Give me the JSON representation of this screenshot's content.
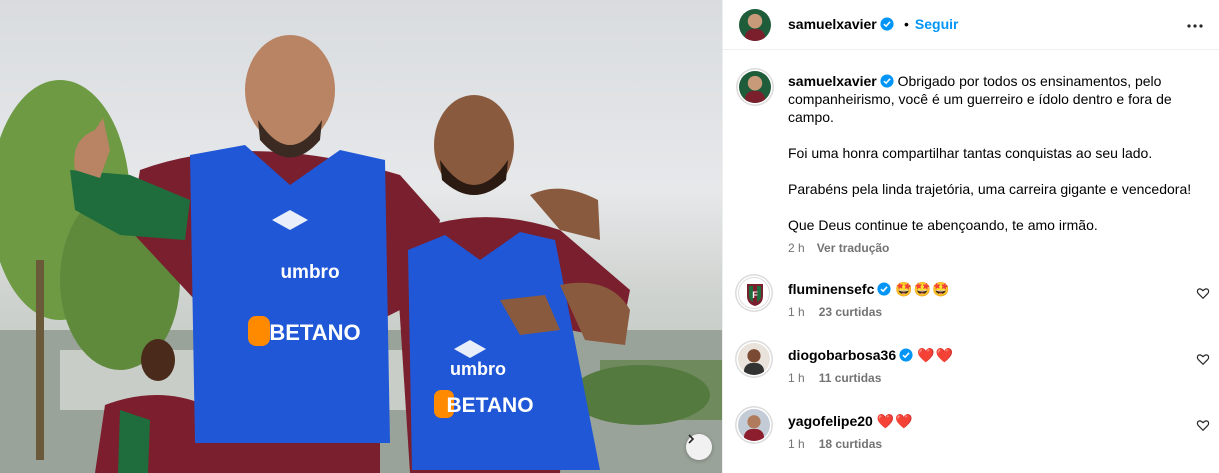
{
  "post": {
    "author": "samuelxavier",
    "follow_label": "Seguir",
    "dot": "•",
    "photo_text": {
      "left_brand": "umbro",
      "left_sponsor": "BETANO",
      "right_brand": "umbro",
      "right_sponsor": "BETANO"
    },
    "caption": {
      "username": "samuelxavier",
      "paragraphs": [
        "Obrigado por todos os ensinamentos, pelo companheirismo, você é um guerreiro e ídolo dentro e fora de campo.",
        "Foi uma honra compartilhar tantas conquistas ao seu lado.",
        "Parabéns pela linda trajetória, uma carreira gigante e vencedora!",
        "Que Deus continue te abençoando, te amo irmão."
      ],
      "time": "2 h",
      "translate_label": "Ver tradução"
    },
    "comments": [
      {
        "username": "fluminensefc",
        "text": "🤩🤩🤩",
        "time": "1 h",
        "likes": "23 curtidas",
        "icon": "fluminense-crest-avatar"
      },
      {
        "username": "diogobarbosa36",
        "text": "❤️❤️",
        "time": "1 h",
        "likes": "11 curtidas",
        "icon": "user-avatar"
      },
      {
        "username": "yagofelipe20",
        "text": "❤️❤️",
        "time": "1 h",
        "likes": "18 curtidas",
        "icon": "user-avatar"
      }
    ]
  },
  "colors": {
    "link_blue": "#0095f6",
    "verified_blue": "#0095f6",
    "meta_gray": "#737373",
    "bib_blue": "#1f57d6",
    "heart_red": "#ed1c3a"
  }
}
